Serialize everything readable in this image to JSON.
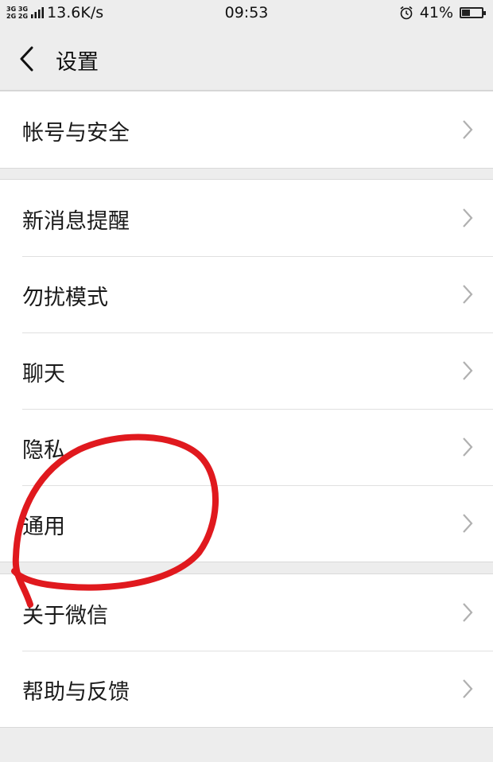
{
  "status_bar": {
    "net_type_top": "3G 3G",
    "net_type_bottom": "2G 2G",
    "speed": "13.6K/s",
    "time": "09:53",
    "battery": "41%",
    "battery_level": 0.41
  },
  "header": {
    "title": "设置",
    "back_icon": "chevron-left-icon"
  },
  "groups": [
    {
      "items": [
        {
          "label": "帐号与安全"
        }
      ]
    },
    {
      "items": [
        {
          "label": "新消息提醒"
        },
        {
          "label": "勿扰模式"
        },
        {
          "label": "聊天"
        },
        {
          "label": "隐私"
        },
        {
          "label": "通用"
        }
      ]
    },
    {
      "items": [
        {
          "label": "关于微信"
        },
        {
          "label": "帮助与反馈"
        }
      ]
    }
  ],
  "annotation": {
    "color": "#e0191e"
  },
  "icons": {
    "chevron": "chevron-right-icon",
    "alarm": "alarm-icon",
    "signal": "signal-icon"
  }
}
